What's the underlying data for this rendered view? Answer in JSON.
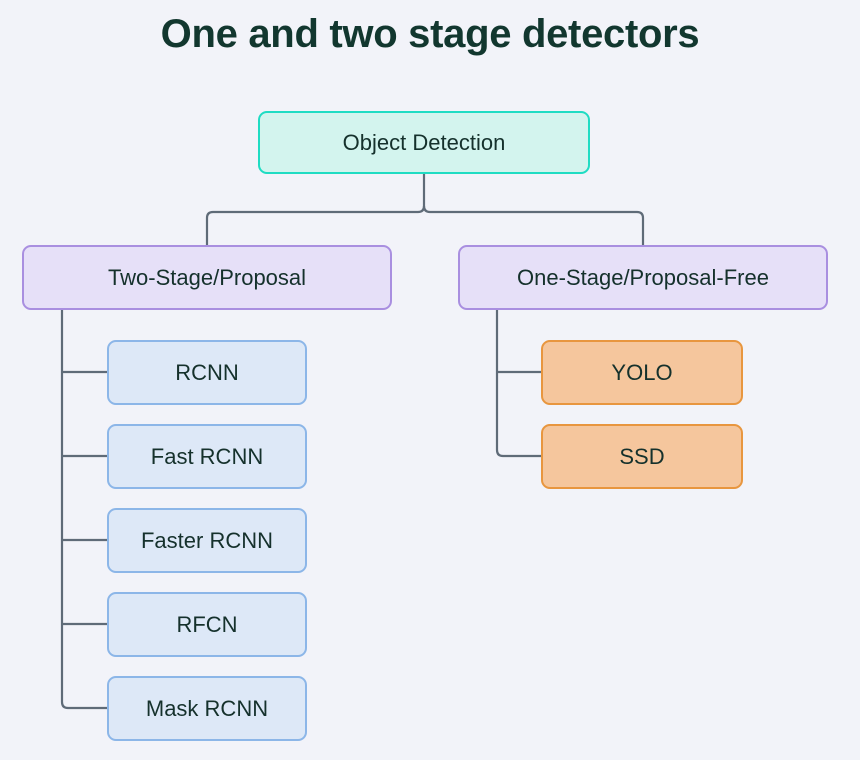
{
  "page": {
    "title": "One and two stage detectors",
    "background_color": "#f2f3f9",
    "title_color": "#12372f"
  },
  "colors": {
    "root_fill": "#d3f4ee",
    "root_border": "#1fdcc3",
    "stage_fill": "#e6e0f8",
    "stage_border": "#a98fe0",
    "leaf_blue_fill": "#dde8f7",
    "leaf_blue_border": "#8cb6e8",
    "leaf_orange_fill": "#f5c69d",
    "leaf_orange_border": "#e8963f",
    "connector": "#5f6b78",
    "text": "#15312c"
  },
  "diagram": {
    "root": {
      "label": "Object Detection"
    },
    "branches": [
      {
        "label": "Two-Stage/Proposal",
        "children": [
          {
            "label": "RCNN"
          },
          {
            "label": "Fast RCNN"
          },
          {
            "label": "Faster RCNN"
          },
          {
            "label": "RFCN"
          },
          {
            "label": "Mask RCNN"
          }
        ]
      },
      {
        "label": "One-Stage/Proposal-Free",
        "children": [
          {
            "label": "YOLO"
          },
          {
            "label": "SSD"
          }
        ]
      }
    ]
  }
}
